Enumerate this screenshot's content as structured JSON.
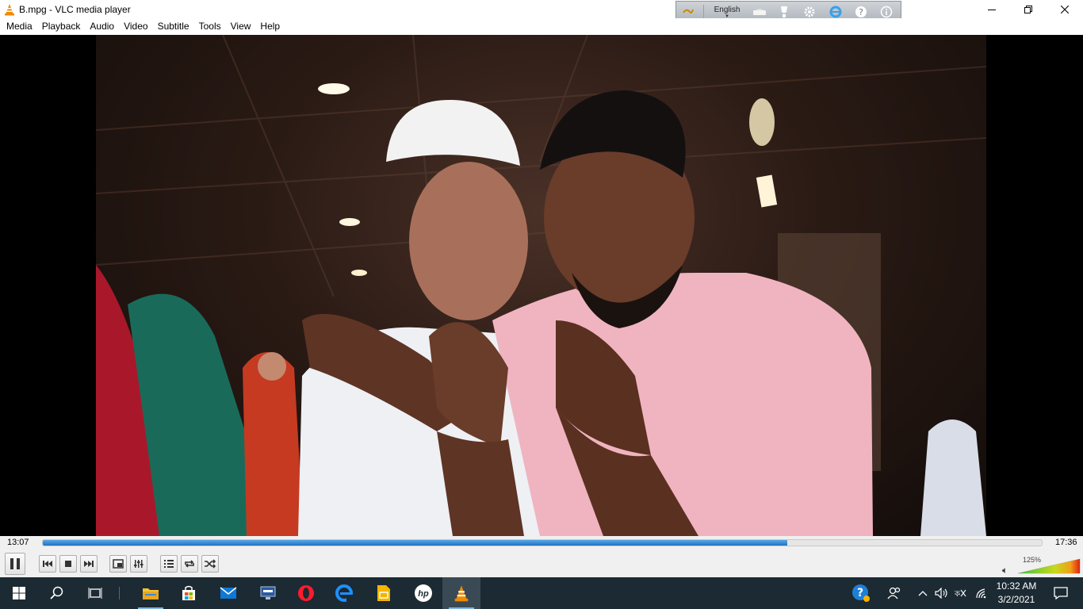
{
  "window": {
    "title": "B.mpg - VLC media player"
  },
  "language_bar": {
    "language": "English"
  },
  "menu": [
    "Media",
    "Playback",
    "Audio",
    "Video",
    "Subtitle",
    "Tools",
    "View",
    "Help"
  ],
  "player": {
    "elapsed": "13:07",
    "total": "17:36",
    "progress_fraction": 0.745,
    "volume_label": "125%",
    "volume_fraction": 1.0
  },
  "taskbar": {
    "clock_time": "10:32 AM",
    "clock_date": "3/2/2021"
  },
  "colors": {
    "taskbar_bg": "#1c2a33",
    "seek_fill": "#1f72c4",
    "vlc_orange": "#f08a00"
  }
}
